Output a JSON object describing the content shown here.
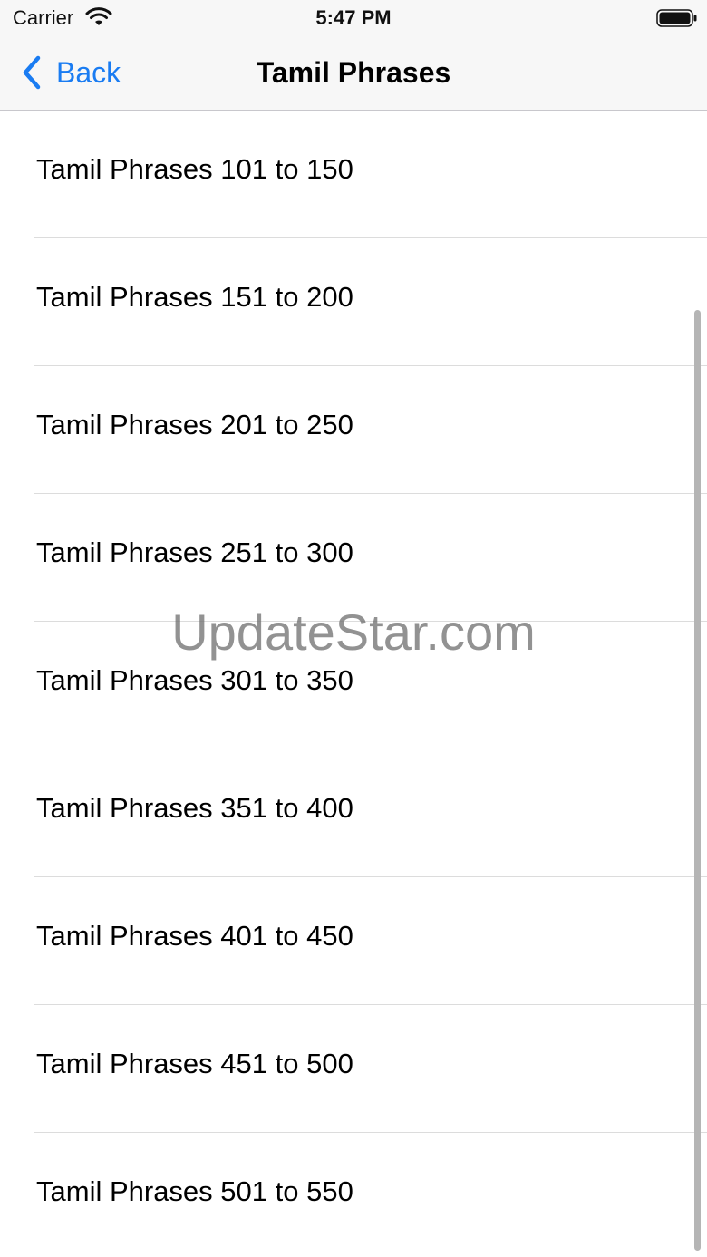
{
  "status_bar": {
    "carrier": "Carrier",
    "time": "5:47 PM",
    "icons": [
      "wifi-icon",
      "battery-icon"
    ]
  },
  "nav": {
    "back_label": "Back",
    "title": "Tamil Phrases",
    "back_icon": "chevron-left-icon",
    "accent_color": "#1a7cf2"
  },
  "list": {
    "items": [
      {
        "label": "Tamil Phrases 101 to 150"
      },
      {
        "label": "Tamil Phrases 151 to 200"
      },
      {
        "label": "Tamil Phrases 201 to 250"
      },
      {
        "label": "Tamil Phrases 251 to 300"
      },
      {
        "label": "Tamil Phrases 301 to 350"
      },
      {
        "label": "Tamil Phrases 351 to 400"
      },
      {
        "label": "Tamil Phrases 401 to 450"
      },
      {
        "label": "Tamil Phrases 451 to 500"
      },
      {
        "label": "Tamil Phrases 501 to 550"
      }
    ]
  },
  "watermark": {
    "text": "UpdateStar.com"
  }
}
